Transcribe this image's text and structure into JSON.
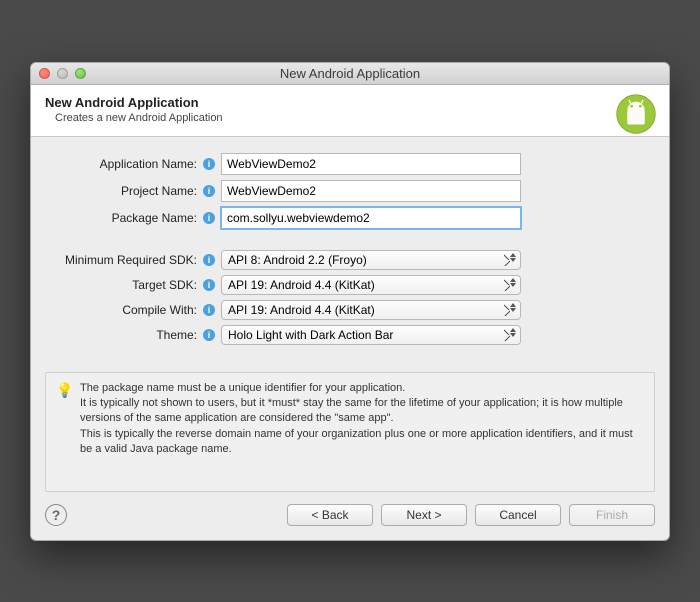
{
  "window": {
    "title": "New Android Application"
  },
  "banner": {
    "heading": "New Android Application",
    "subheading": "Creates a new Android Application"
  },
  "fields": {
    "app_name": {
      "label": "Application Name:",
      "value": "WebViewDemo2"
    },
    "project_name": {
      "label": "Project Name:",
      "value": "WebViewDemo2"
    },
    "package_name": {
      "label": "Package Name:",
      "value": "com.sollyu.webviewdemo2"
    },
    "min_sdk": {
      "label": "Minimum Required SDK:",
      "value": "API 8: Android 2.2 (Froyo)"
    },
    "target_sdk": {
      "label": "Target SDK:",
      "value": "API 19: Android 4.4 (KitKat)"
    },
    "compile": {
      "label": "Compile With:",
      "value": "API 19: Android 4.4 (KitKat)"
    },
    "theme": {
      "label": "Theme:",
      "value": "Holo Light with Dark Action Bar"
    }
  },
  "hint": {
    "line1": "The package name must be a unique identifier for your application.",
    "line2": "It is typically not shown to users, but it *must* stay the same for the lifetime of your application; it is how multiple versions of the same application are considered the \"same app\".",
    "line3": "This is typically the reverse domain name of your organization plus one or more application identifiers, and it must be a valid Java package name."
  },
  "buttons": {
    "back": "< Back",
    "next": "Next >",
    "cancel": "Cancel",
    "finish": "Finish"
  }
}
